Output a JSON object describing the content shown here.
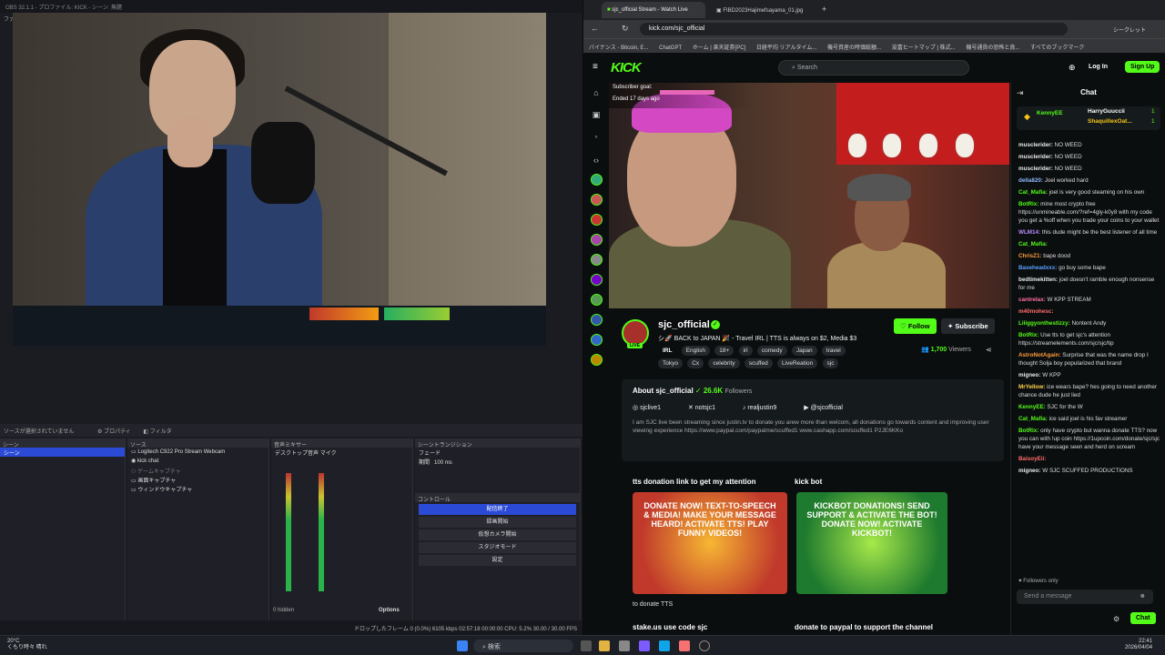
{
  "obs": {
    "title": "OBS 32.1.1 - プロファイル: KICK - シーン: 無題",
    "menu_label": "ファ",
    "source_notice": "ソースが選択されていません",
    "properties_label": "プロパティ",
    "filters_label": "フィルタ",
    "scenes_header": "シーン",
    "scenes": [
      "シーン"
    ],
    "sources_header": "ソース",
    "sources": [
      "Logitech C922 Pro Stream Webcam",
      "kick chat",
      "ゲームキャプチャ",
      "画面キャプチャ",
      "ウィンドウキャプチャ"
    ],
    "mixer_header": "音声ミキサー",
    "mixer_channels": [
      "デスクトップ音声",
      "マイク"
    ],
    "transition_header": "シーントランジション",
    "transition_value": "フェード",
    "duration_label": "期間",
    "duration_value": "100 ms",
    "controls_header": "コントロール",
    "controls": [
      "配信終了",
      "録画開始",
      "仮想カメラ開始",
      "スタジオモード",
      "設定"
    ],
    "hidden_label": "0 hidden",
    "options_label": "Options",
    "status_text": "ドロップしたフレーム 0 (0.0%)   6105 kbps   02:57:18   00:00:00   CPU: 5.2%   30.00 / 30.00 FPS"
  },
  "browser": {
    "tabs": [
      "sjc_official Stream - Watch Live",
      "FIBD2023Hajimefsayama_01.jpg"
    ],
    "url": "kick.com/sjc_official",
    "incognito_label": "シークレット",
    "bookmarks": [
      "バイナンス - Bitcoin, E...",
      "ChatGPT",
      "ホーム | 楽天証券[PC]",
      "日経平均 リアルタイム...",
      "機号資産の時価総額...",
      "浚富ヒートマップ | 株式...",
      "機号通貨の恐怖と貪..."
    ],
    "all_bookmarks_label": "すべてのブックマーク"
  },
  "kick": {
    "logo": "KICK",
    "search_placeholder": "Search",
    "login_label": "Log In",
    "signup_label": "Sign Up",
    "goal_label": "Subscriber goal:",
    "goal_ended": "Ended 17 days ago",
    "goal_progress": 0.6,
    "channel_name": "sjc_official",
    "live_badge": "LIVE",
    "stream_title": "シ🚀 BACK to JAPAN 🎉 - Travel IRL | TTS is always on $2, Media $3",
    "tags": [
      "IRL",
      "English",
      "18+",
      "irl",
      "comedy",
      "Japan",
      "travel",
      "Tokyo",
      "Cx",
      "celebrity",
      "scuffed",
      "LiveReation",
      "sjc"
    ],
    "follow_label": "Follow",
    "subscribe_label": "Subscribe",
    "viewers_count": "1,700",
    "viewers_label": "Viewers",
    "about_title": "About sjc_official",
    "followers_count": "26.6K",
    "followers_label": "Followers",
    "socials": [
      "sjclive1",
      "notsjc1",
      "realjustin9",
      "@sjcofficial"
    ],
    "about_desc": "I am SJC live been streaming since justin.tv to donate you arew more than welcom, all donations go towards content and improving user viewing experience https://www.paypal.com/paypalme/scuffed1 www.cashapp.com/scuffed1 P2JE6KKo",
    "panel1_title": "tts donation link to get my attention",
    "panel1_img_text": "DONATE NOW! TEXT-TO-SPEECH & MEDIA! MAKE YOUR MESSAGE HEARD! ACTIVATE TTS! PLAY FUNNY VIDEOS!",
    "panel1_caption": "to donate TTS",
    "panel2_title": "kick bot",
    "panel2_img_text": "KICKBOT DONATIONS! SEND SUPPORT & ACTIVATE THE BOT! DONATE NOW! ACTIVATE KICKBOT!",
    "panel3_title": "stake.us use code sjc",
    "panel4_title": "donate to paypal to support the channel"
  },
  "chat": {
    "title": "Chat",
    "pinned": [
      {
        "user": "KennyEE",
        "count": ""
      },
      {
        "user": "HarryGuuccii",
        "count": "1"
      },
      {
        "user": "ShaquillexOat...",
        "count": "1"
      }
    ],
    "messages": [
      {
        "user": "musclerider:",
        "text": "NO WEED",
        "color": "#e8e8e8"
      },
      {
        "user": "musclerider:",
        "text": "NO WEED",
        "color": "#e8e8e8"
      },
      {
        "user": "musclerider:",
        "text": "NO WEED",
        "color": "#e8e8e8"
      },
      {
        "user": "della820:",
        "text": "Joel worked hard",
        "color": "#8fb8ff"
      },
      {
        "user": "Cat_Mafia:",
        "text": "joel is very good steaming on his own",
        "color": "#53fc18"
      },
      {
        "user": "BotRix:",
        "text": "mine most crypto free https://unmineable.com/?ref=4gly-k0y8 with my code you get a %off when you trade your coins to your wallet",
        "color": "#53fc18"
      },
      {
        "user": "WLM14:",
        "text": "this dude might be the best listener of all time",
        "color": "#b68cff"
      },
      {
        "user": "Cat_Mafia:",
        "text": "",
        "color": "#53fc18"
      },
      {
        "user": "ChrisZ1:",
        "text": "bape dood",
        "color": "#ff9a3c"
      },
      {
        "user": "Baseheadxxx:",
        "text": "go buy some bape",
        "color": "#5aa0ff"
      },
      {
        "user": "bedtimekitten:",
        "text": "joel doesn't ramble enough nonsense for me",
        "color": "#e8e8e8"
      },
      {
        "user": "cantrelax:",
        "text": "W KPP STREAM",
        "color": "#ff6fa0"
      },
      {
        "user": "m40mohesc:",
        "text": "",
        "color": "#ff6b6b"
      },
      {
        "user": "Liiiggyonthestizzy:",
        "text": "Nontent Andy",
        "color": "#53fc18"
      },
      {
        "user": "BotRix:",
        "text": "Use tts to get sjc's attention https://streamelements.com/sjc/sjc/tip",
        "color": "#53fc18"
      },
      {
        "user": "AstroNotAgain:",
        "text": "Surprise that was the name drop I thought Solja boy popularized that brand",
        "color": "#ff9a3c"
      },
      {
        "user": "migneo:",
        "text": "W KPP",
        "color": "#e8e8e8"
      },
      {
        "user": "MrYellow:",
        "text": "ice wears bape? hes going to need another chance dude he just lied",
        "color": "#ffd34d"
      },
      {
        "user": "KennyEE:",
        "text": "SJC for the W",
        "color": "#53fc18"
      },
      {
        "user": "Cat_Mafia:",
        "text": "ice said joel is his fav streamer",
        "color": "#53fc18"
      },
      {
        "user": "BotRix:",
        "text": "only have crypto but wanna donate TTS? now you can with !up coin https://1upcoin.com/donate/sjc/sjc have your message seen and herd on scream",
        "color": "#53fc18"
      },
      {
        "user": "BaisoyEii:",
        "text": "",
        "color": "#ff6b6b"
      },
      {
        "user": "migneo:",
        "text": "W SJC SCUFFED PRODUCTIONS",
        "color": "#e8e8e8"
      }
    ],
    "followers_only": "Followers only",
    "input_placeholder": "Send a message",
    "send_label": "Chat"
  },
  "taskbar": {
    "weather_temp": "20°C",
    "weather_desc": "くもり時々 晴れ",
    "search_label": "検索",
    "time": "22:41",
    "date": "2026/04/04"
  }
}
